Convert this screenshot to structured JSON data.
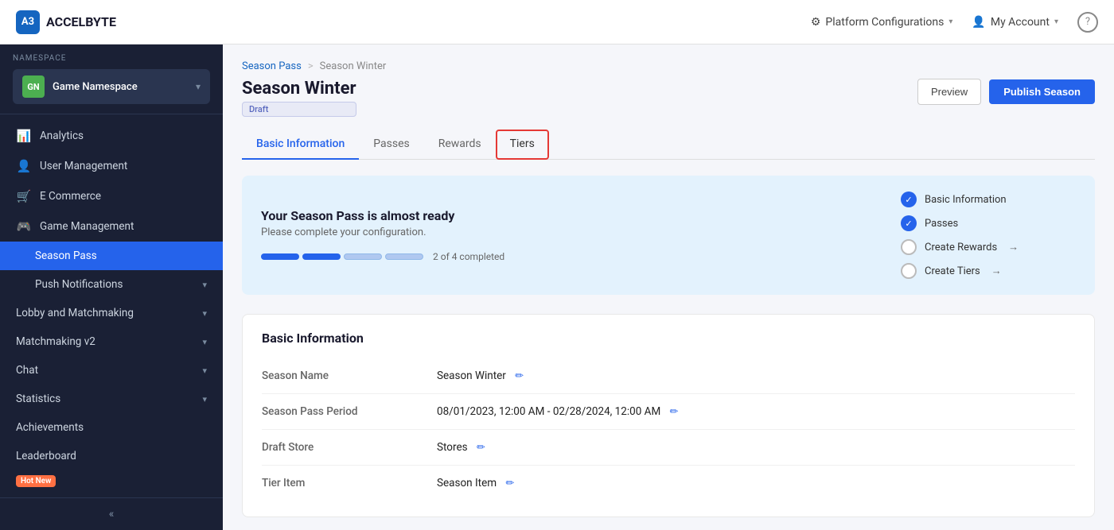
{
  "topbar": {
    "logo_text": "ACCELBYTE",
    "logo_initials": "A3",
    "platform_config": "Platform Configurations",
    "my_account": "My Account",
    "help": "?"
  },
  "sidebar": {
    "namespace_label": "NAMESPACE",
    "namespace_badge": "GN",
    "namespace_name": "Game Namespace",
    "items": [
      {
        "id": "analytics",
        "label": "Analytics",
        "icon": "📊"
      },
      {
        "id": "user-management",
        "label": "User Management",
        "icon": "👤"
      },
      {
        "id": "ecommerce",
        "label": "E Commerce",
        "icon": "🛒"
      },
      {
        "id": "game-management",
        "label": "Game Management",
        "icon": "🎮"
      },
      {
        "id": "season-pass",
        "label": "Season Pass",
        "icon": "",
        "sub": true
      },
      {
        "id": "push-notifications",
        "label": "Push Notifications",
        "icon": "",
        "sub": false,
        "hasArrow": true
      },
      {
        "id": "lobby-matchmaking",
        "label": "Lobby and Matchmaking",
        "icon": "",
        "hasArrow": true
      },
      {
        "id": "matchmaking-v2",
        "label": "Matchmaking v2",
        "icon": "",
        "hasArrow": true
      },
      {
        "id": "chat",
        "label": "Chat",
        "icon": "",
        "hasArrow": true
      },
      {
        "id": "statistics",
        "label": "Statistics",
        "icon": "",
        "hasArrow": true
      },
      {
        "id": "achievements",
        "label": "Achievements",
        "icon": ""
      },
      {
        "id": "leaderboard",
        "label": "Leaderboard",
        "icon": ""
      }
    ],
    "collapse_label": "«"
  },
  "breadcrumb": {
    "parent": "Season Pass",
    "separator": ">",
    "current": "Season Winter"
  },
  "page_header": {
    "title": "Season Winter",
    "status_badge": "Draft",
    "btn_preview": "Preview",
    "btn_publish": "Publish Season"
  },
  "tabs": [
    {
      "id": "basic-information",
      "label": "Basic Information",
      "active": true
    },
    {
      "id": "passes",
      "label": "Passes"
    },
    {
      "id": "rewards",
      "label": "Rewards"
    },
    {
      "id": "tiers",
      "label": "Tiers",
      "highlighted": true
    }
  ],
  "progress_banner": {
    "title": "Your Season Pass is almost ready",
    "subtitle": "Please complete your configuration.",
    "progress_text": "2 of 4 completed",
    "segments": [
      {
        "filled": true
      },
      {
        "filled": true
      },
      {
        "filled": false
      },
      {
        "filled": false
      }
    ],
    "checklist": [
      {
        "id": "basic-info",
        "label": "Basic Information",
        "done": true
      },
      {
        "id": "passes",
        "label": "Passes",
        "done": true
      },
      {
        "id": "create-rewards",
        "label": "Create Rewards",
        "done": false,
        "arrow": true
      },
      {
        "id": "create-tiers",
        "label": "Create Tiers",
        "done": false,
        "arrow": true
      }
    ]
  },
  "basic_information": {
    "section_title": "Basic Information",
    "fields": [
      {
        "label": "Season Name",
        "value": "Season Winter",
        "editable": true
      },
      {
        "label": "Season Pass Period",
        "value": "08/01/2023, 12:00 AM - 02/28/2024, 12:00 AM",
        "editable": true
      },
      {
        "label": "Draft Store",
        "value": "Stores",
        "editable": true
      },
      {
        "label": "Tier Item",
        "value": "Season Item",
        "editable": true
      }
    ]
  }
}
